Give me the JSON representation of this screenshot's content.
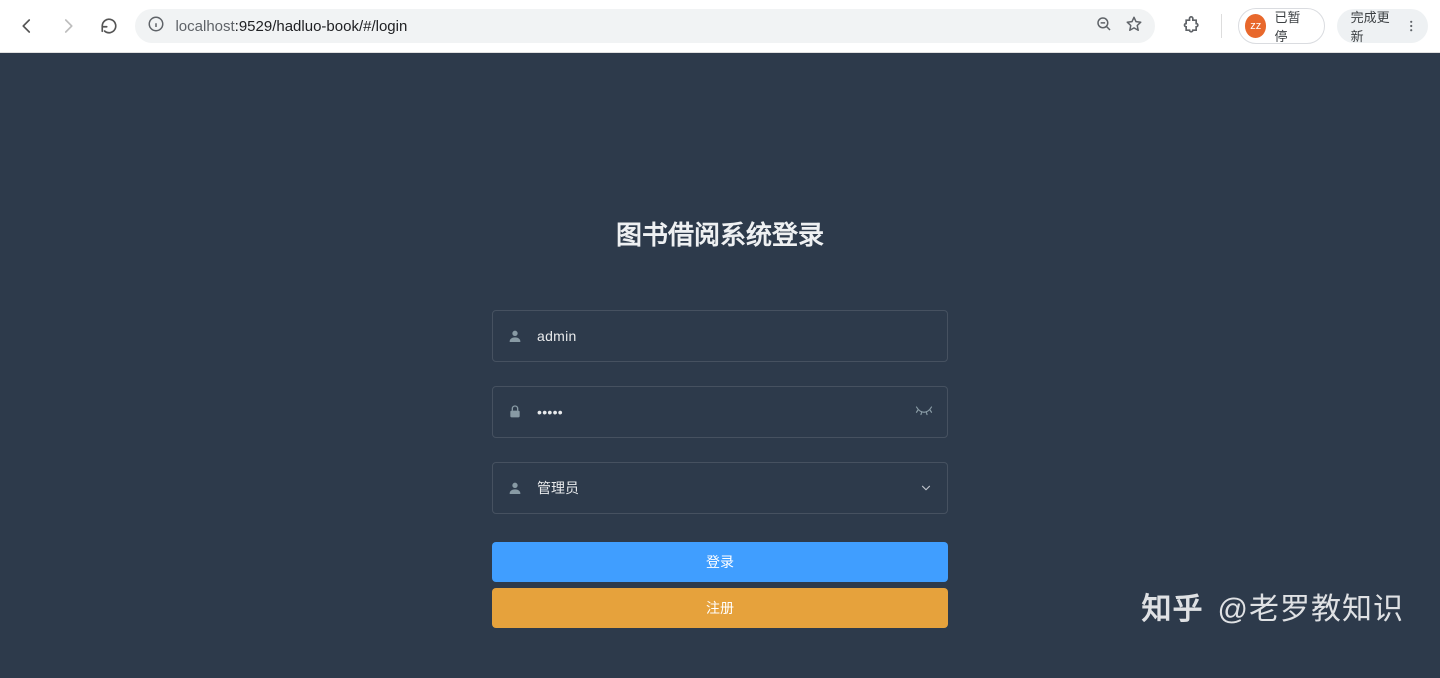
{
  "browser": {
    "url_host": "localhost",
    "url_rest": ":9529/hadluo-book/#/login",
    "profile_initials": "zz",
    "profile_label": "已暂停",
    "update_label": "完成更新"
  },
  "login": {
    "title": "图书借阅系统登录",
    "username_value": "admin",
    "password_value": "•••••",
    "role_value": "管理员",
    "login_button": "登录",
    "register_button": "注册"
  },
  "watermark": {
    "logo": "知乎",
    "handle": "@老罗教知识"
  }
}
